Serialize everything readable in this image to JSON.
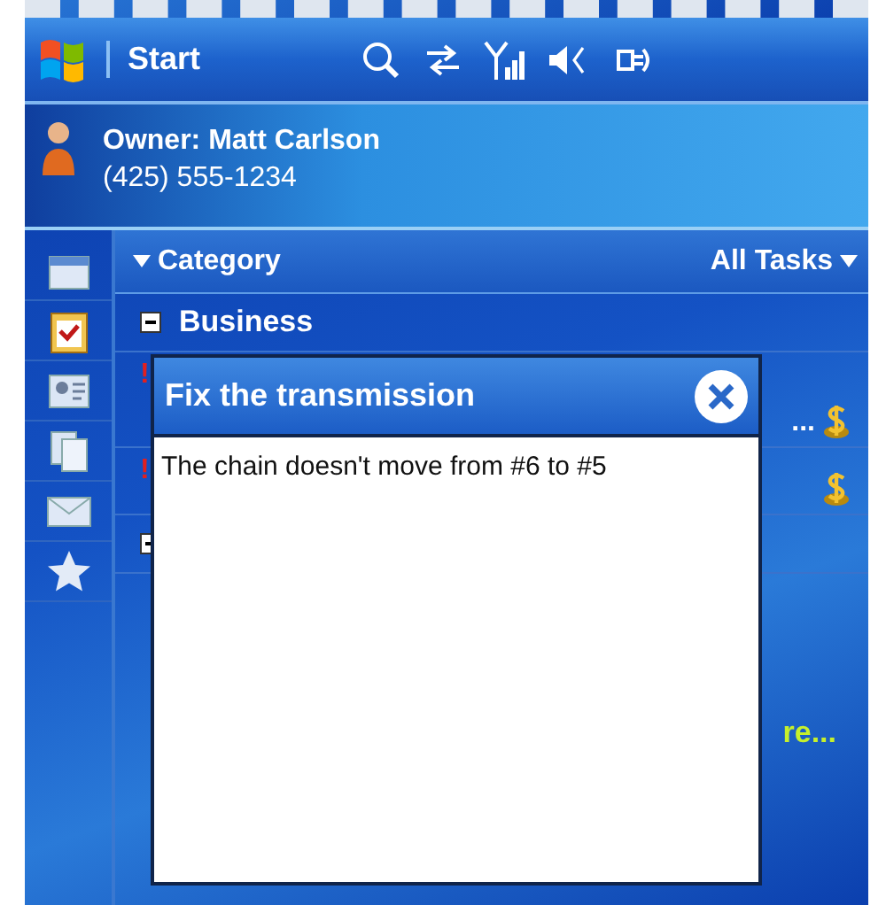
{
  "taskbar": {
    "start_label": "Start"
  },
  "owner": {
    "name": "Owner: Matt Carlson",
    "phone": "(425) 555-1234"
  },
  "header": {
    "sort_label": "Category",
    "filter_label": "All Tasks"
  },
  "groups": [
    {
      "name": "Business",
      "expanded": true,
      "tasks": [
        {
          "priority_mark": "!",
          "trailing_text": "...",
          "kind": "money"
        },
        {
          "priority_mark": "!",
          "kind": "money"
        }
      ]
    },
    {
      "expanded": true
    }
  ],
  "more_link": "re...",
  "popup": {
    "title": "Fix the transmission",
    "body": "The chain doesn't move from #6 to #5"
  }
}
